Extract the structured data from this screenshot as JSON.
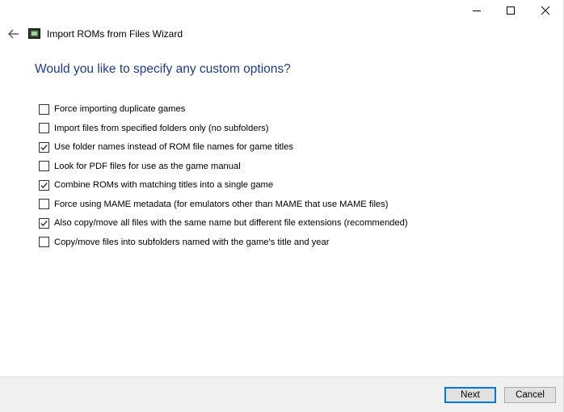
{
  "window": {
    "title": "Import ROMs from Files Wizard",
    "minimize_icon": "minimize-icon",
    "maximize_icon": "maximize-icon",
    "close_icon": "close-icon",
    "back_icon": "back-arrow-icon",
    "app_icon": "launchbox-app-icon"
  },
  "page": {
    "heading": "Would you like to specify any custom options?"
  },
  "options": [
    {
      "label": "Force importing duplicate games",
      "checked": false
    },
    {
      "label": "Import files from specified folders only (no subfolders)",
      "checked": false
    },
    {
      "label": "Use folder names instead of ROM file names for game titles",
      "checked": true
    },
    {
      "label": "Look for PDF files for use as the game manual",
      "checked": false
    },
    {
      "label": "Combine ROMs with matching titles into a single game",
      "checked": true
    },
    {
      "label": "Force using MAME metadata (for emulators other than MAME that use MAME files)",
      "checked": false
    },
    {
      "label": "Also copy/move all files with the same name but different file extensions (recommended)",
      "checked": true
    },
    {
      "label": "Copy/move files into subfolders named with the game's title and year",
      "checked": false
    }
  ],
  "footer": {
    "next_label": "Next",
    "cancel_label": "Cancel"
  },
  "colors": {
    "heading": "#1f3c8c",
    "default_button_border": "#0078d7",
    "footer_background": "#f0f0f0"
  }
}
